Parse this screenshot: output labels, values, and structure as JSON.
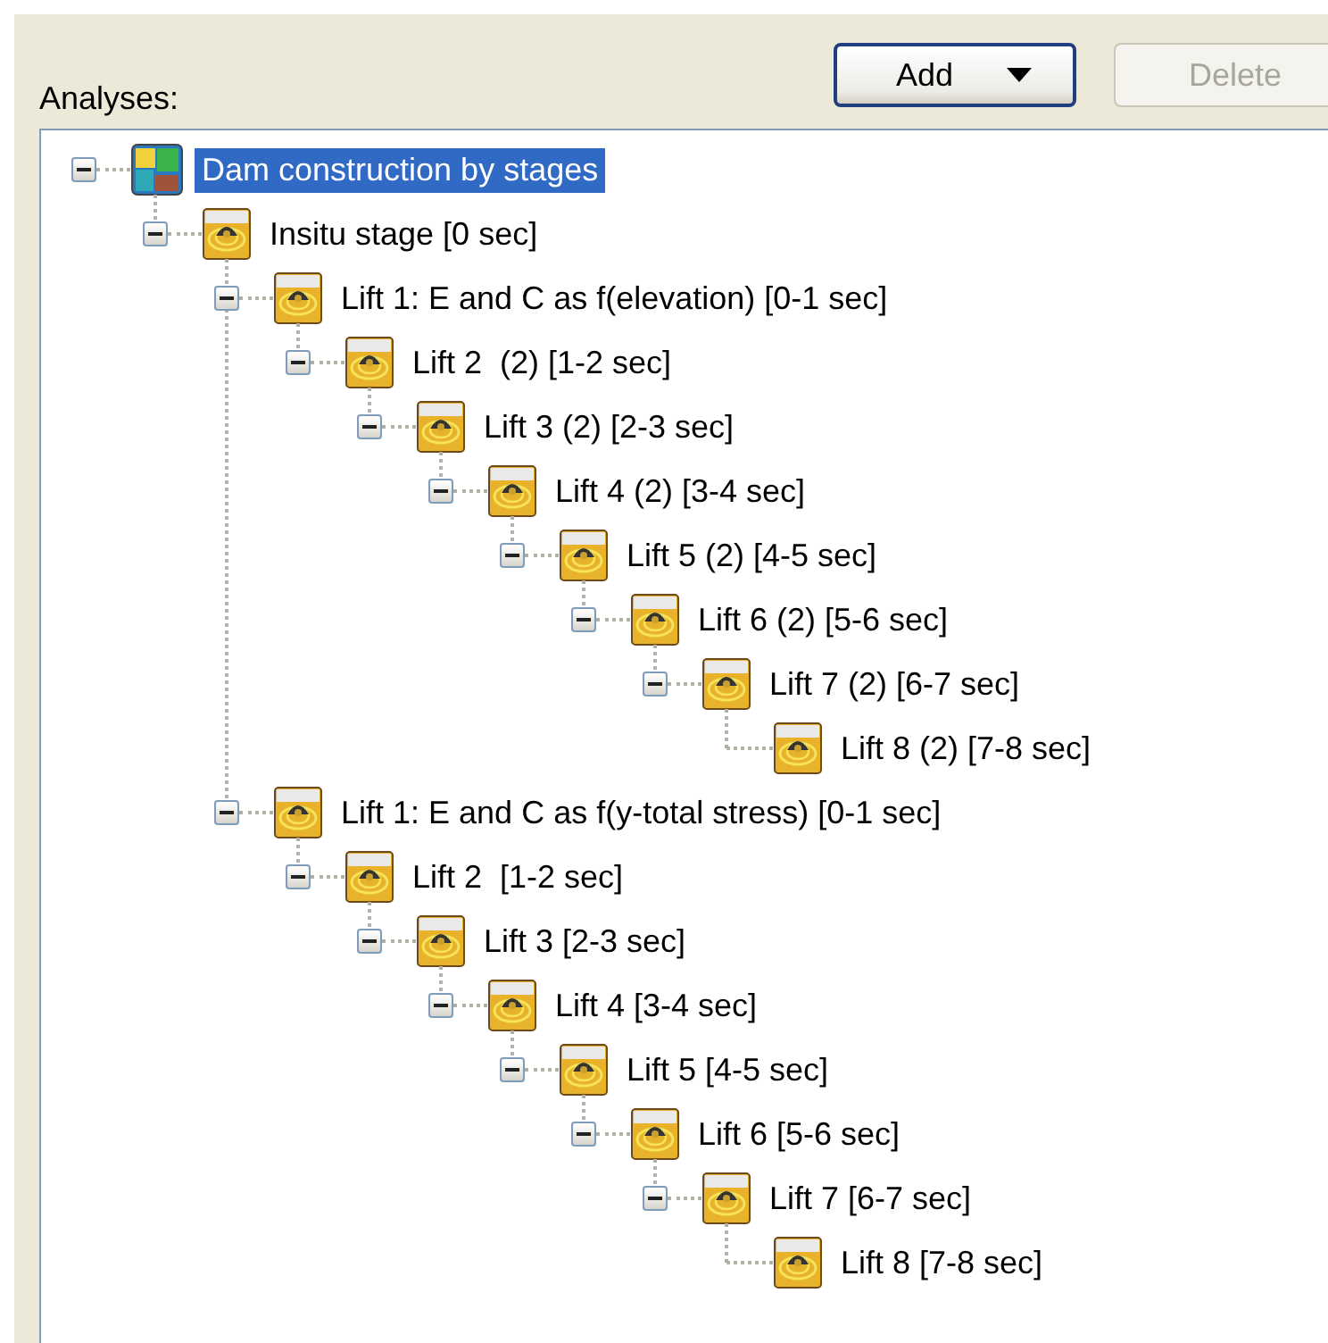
{
  "label": "Analyses:",
  "buttons": [
    {
      "label": "Add",
      "dropdown": true,
      "disabled": false
    },
    {
      "label": "Delete",
      "dropdown": false,
      "disabled": true
    }
  ],
  "tree": [
    {
      "label": "Dam construction by stages",
      "kind": "model",
      "selected": true,
      "expanded": true,
      "children": [
        {
          "label": "Insitu stage [0 sec]",
          "kind": "stage",
          "selected": false,
          "expanded": true,
          "children": [
            {
              "label": "Lift 1: E and C as f(elevation) [0-1 sec]",
              "kind": "stage",
              "selected": false,
              "expanded": true,
              "children": [
                {
                  "label": "Lift 2  (2) [1-2 sec]",
                  "kind": "stage",
                  "selected": false,
                  "expanded": true,
                  "children": [
                    {
                      "label": "Lift 3 (2) [2-3 sec]",
                      "kind": "stage",
                      "selected": false,
                      "expanded": true,
                      "children": [
                        {
                          "label": "Lift 4 (2) [3-4 sec]",
                          "kind": "stage",
                          "selected": false,
                          "expanded": true,
                          "children": [
                            {
                              "label": "Lift 5 (2) [4-5 sec]",
                              "kind": "stage",
                              "selected": false,
                              "expanded": true,
                              "children": [
                                {
                                  "label": "Lift 6 (2) [5-6 sec]",
                                  "kind": "stage",
                                  "selected": false,
                                  "expanded": true,
                                  "children": [
                                    {
                                      "label": "Lift 7 (2) [6-7 sec]",
                                      "kind": "stage",
                                      "selected": false,
                                      "expanded": true,
                                      "children": [
                                        {
                                          "label": "Lift 8 (2) [7-8 sec]",
                                          "kind": "stage",
                                          "selected": false
                                        }
                                      ]
                                    }
                                  ]
                                }
                              ]
                            }
                          ]
                        }
                      ]
                    }
                  ]
                }
              ]
            },
            {
              "label": "Lift 1: E and C as f(y-total stress) [0-1 sec]",
              "kind": "stage",
              "selected": false,
              "expanded": true,
              "children": [
                {
                  "label": "Lift 2  [1-2 sec]",
                  "kind": "stage",
                  "selected": false,
                  "expanded": true,
                  "children": [
                    {
                      "label": "Lift 3 [2-3 sec]",
                      "kind": "stage",
                      "selected": false,
                      "expanded": true,
                      "children": [
                        {
                          "label": "Lift 4 [3-4 sec]",
                          "kind": "stage",
                          "selected": false,
                          "expanded": true,
                          "children": [
                            {
                              "label": "Lift 5 [4-5 sec]",
                              "kind": "stage",
                              "selected": false,
                              "expanded": true,
                              "children": [
                                {
                                  "label": "Lift 6 [5-6 sec]",
                                  "kind": "stage",
                                  "selected": false,
                                  "expanded": true,
                                  "children": [
                                    {
                                      "label": "Lift 7 [6-7 sec]",
                                      "kind": "stage",
                                      "selected": false,
                                      "expanded": true,
                                      "children": [
                                        {
                                          "label": "Lift 8 [7-8 sec]",
                                          "kind": "stage",
                                          "selected": false
                                        }
                                      ]
                                    }
                                  ]
                                }
                              ]
                            }
                          ]
                        }
                      ]
                    }
                  ]
                }
              ]
            }
          ]
        }
      ]
    }
  ]
}
